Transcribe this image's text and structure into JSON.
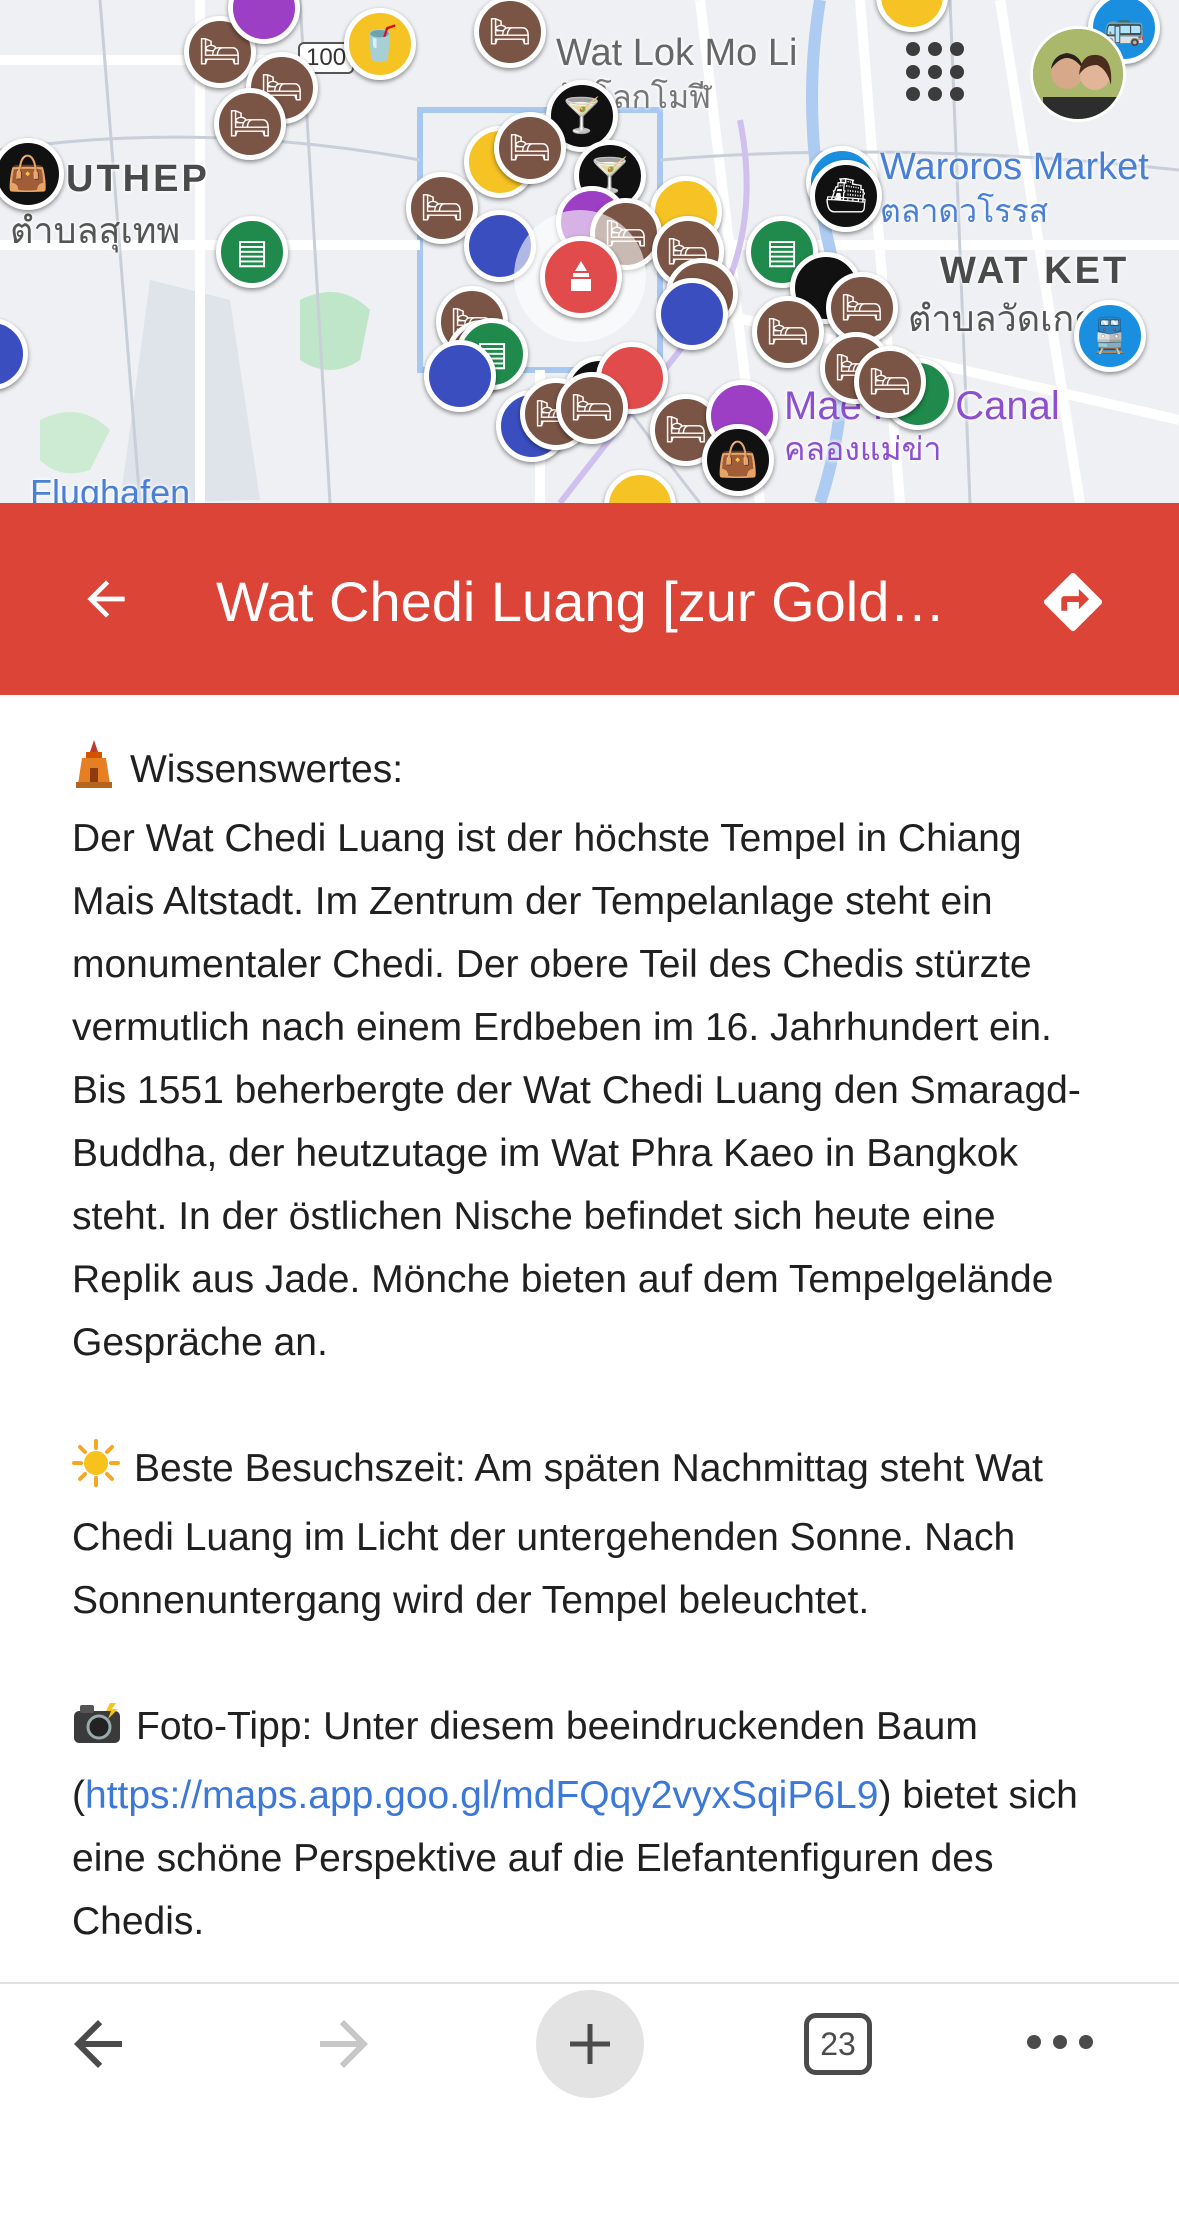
{
  "map": {
    "labels": {
      "wat_lok_mo_li": "Wat Lok Mo Li",
      "wat_lok_mo_li_thai": "วัดโลกโมฬี",
      "suthep": "UTHEP",
      "suthep_thai": "ตำบลสุเทพ",
      "waroros": "Waroros Market",
      "waroros_thai": "ตลาดวโรรส",
      "wat_ket": "WAT KET",
      "wat_ket_thai": "ตำบลวัดเกต",
      "canal": "Mae Kha Canal",
      "canal_thai": "คลองแม่ข่า",
      "airport": "Flughafen",
      "road_sign": "100"
    },
    "colors": {
      "hotel": "#7a5444",
      "temple_selected": "#e24b4b",
      "park": "#1f8a4c",
      "food": "#f6c324",
      "bar": "#111111",
      "transit": "#1a8fe0"
    }
  },
  "header": {
    "title": "Wat Chedi Luang [zur Gold…",
    "background": "#db4437"
  },
  "content": {
    "wissenswertes_label": "Wissenswertes:",
    "wissenswertes_text": "Der Wat Chedi Luang ist der höchste Tempel in Chiang Mais Altstadt. Im Zentrum der Tempelanlage steht ein monumentaler Chedi. Der obere Teil des Chedis stürzte vermutlich nach einem Erdbeben im 16. Jahrhundert ein. Bis 1551 beherbergte der Wat Chedi Luang den Smaragd-Buddha, der heutzutage im Wat Phra Kaeo in Bangkok steht. In der östlichen Nische befindet sich heute eine Replik aus Jade. Mönche bieten auf dem Tempelgelände Gespräche an.",
    "besuchszeit_text": "Beste Besuchszeit: Am späten Nachmittag steht Wat Chedi Luang im Licht der untergehenden Sonne. Nach Sonnenuntergang wird der Tempel beleuchtet.",
    "foto_text_before": "Foto-Tipp: Unter diesem beeindruckenden Baum (",
    "foto_link": "https://maps.app.goo.gl/mdFQqy2vyxSqiP6L9",
    "foto_text_after": ") bietet sich eine schöne Perspektive auf die Elefantenfiguren des Chedis."
  },
  "bottombar": {
    "tab_count": "23",
    "icons": [
      "back-arrow-icon",
      "forward-arrow-icon",
      "plus-icon",
      "tabs-icon",
      "more-icon"
    ]
  }
}
